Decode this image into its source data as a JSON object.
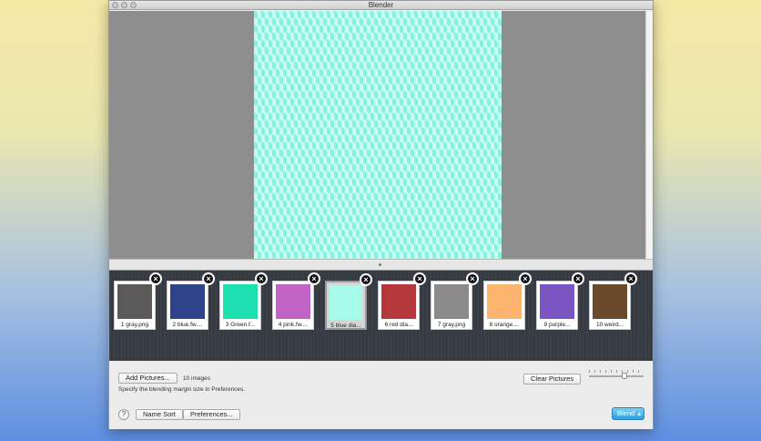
{
  "window": {
    "title": "Blender"
  },
  "thumbnails": [
    {
      "label": "1 gray.png",
      "color": "#5a5a5a"
    },
    {
      "label": "2 blue.fw....",
      "color": "#2f438a"
    },
    {
      "label": "3 Green.f...",
      "color": "#1ddfb0"
    },
    {
      "label": "4 pink.fw....",
      "color": "#c063c4"
    },
    {
      "label": "5 blue dia...",
      "color": "#a6fbea",
      "selected": true
    },
    {
      "label": "6 red dia...",
      "color": "#b4383b"
    },
    {
      "label": "7 gray.png",
      "color": "#8a8a8a"
    },
    {
      "label": "8 orange....",
      "color": "#fdb46e"
    },
    {
      "label": "9 purple...",
      "color": "#7b55c2"
    },
    {
      "label": "10 weird...",
      "color": "#6b4a2b"
    }
  ],
  "bottom": {
    "add_pictures": "Add Pictures...",
    "image_count": "10 images",
    "hint": "Specify the blending margin size in Preferences.",
    "clear_pictures": "Clear Pictures",
    "help": "?",
    "name_sort": "Name Sort",
    "preferences": "Preferences...",
    "blend": "Blend",
    "blend_arrow": "▲"
  },
  "zoom_slider": {
    "value": 0.6
  }
}
